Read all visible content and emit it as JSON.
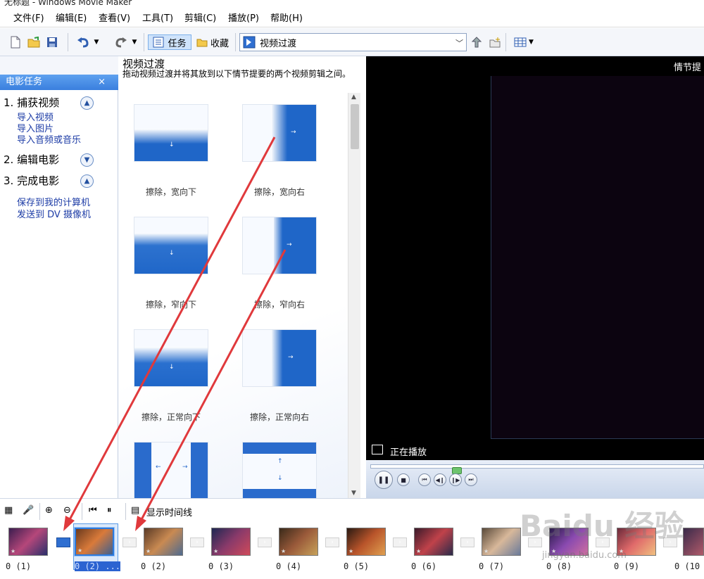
{
  "window": {
    "title": "无标题 - Windows Movie Maker"
  },
  "menu": [
    "文件(F)",
    "编辑(E)",
    "查看(V)",
    "工具(T)",
    "剪辑(C)",
    "播放(P)",
    "帮助(H)"
  ],
  "toolbar": {
    "tasks_label": "任务",
    "favorites_label": "收藏",
    "collection_value": "视频过渡"
  },
  "taskpane": {
    "header": "电影任务",
    "close": "×",
    "sections": [
      {
        "label": "1.  捕获视频",
        "links": [
          "导入视频",
          "导入图片",
          "导入音频或音乐"
        ]
      },
      {
        "label": "2.  编辑电影",
        "links": []
      },
      {
        "label": "3.  完成电影",
        "links": [
          "保存到我的计算机",
          "发送到 DV 摄像机"
        ]
      }
    ]
  },
  "transitions": {
    "title": "视频过渡",
    "description": "拖动视频过渡并将其放到以下情节提要的两个视频剪辑之间。",
    "items": [
      "擦除，宽向下",
      "擦除，宽向右",
      "擦除，窄向下",
      "擦除，窄向右",
      "擦除，正常向下",
      "擦除，正常向右",
      "",
      ""
    ]
  },
  "preview": {
    "title": "情节提",
    "status": "正在播放",
    "seek_position": 0.25
  },
  "storyboard": {
    "show_timeline_label": "显示时间线",
    "clips": [
      "0 (1)",
      "0 (2) ...",
      "0 (2)",
      "0 (3)",
      "0 (4)",
      "0 (5)",
      "0 (6)",
      "0 (7)",
      "0 (8)",
      "0 (9)",
      "0 (10"
    ]
  },
  "watermark": {
    "brand": "Baidu 经验",
    "url": "jingyan.baidu.com"
  },
  "colors": {
    "accent": "#3a7fde",
    "annotation_arrow": "#e0393c",
    "selection": "#2b7be0"
  }
}
